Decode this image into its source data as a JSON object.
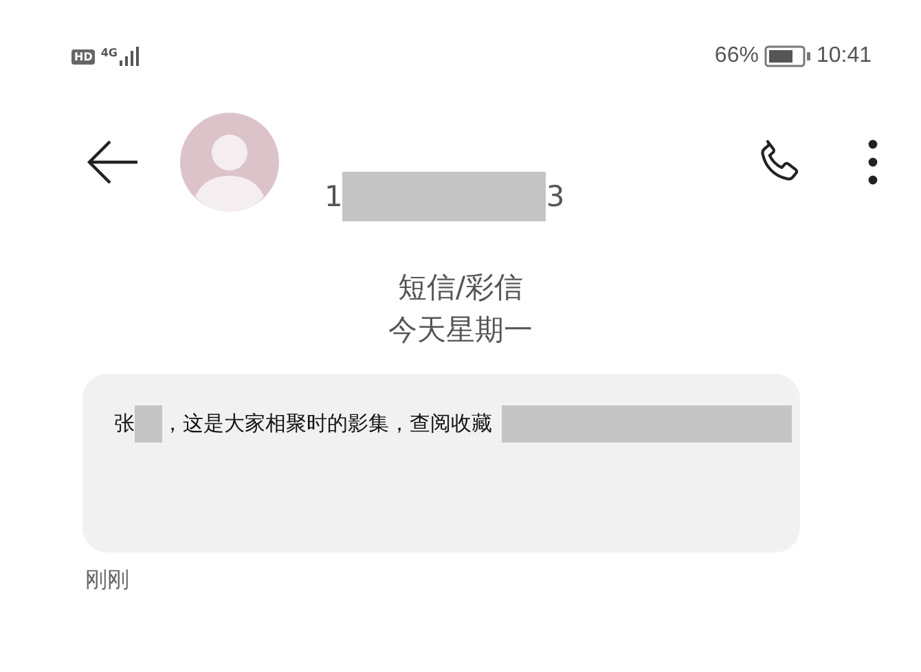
{
  "status_bar": {
    "hd_badge": "HD",
    "network": "4G",
    "battery": "66%",
    "time": "10:41"
  },
  "header": {
    "number": [
      {
        "kind": "text",
        "text": "1"
      },
      {
        "kind": "redacted"
      },
      {
        "kind": "text",
        "text": "3"
      }
    ]
  },
  "conversation": {
    "channel": "短信/彩信",
    "date": "今天星期一"
  },
  "messages": [
    {
      "parts": [
        {
          "kind": "text",
          "text": "张"
        },
        {
          "kind": "redacted"
        },
        {
          "kind": "text",
          "text": "，这是大家相聚时的影集，查阅收藏"
        },
        {
          "kind": "redacted"
        }
      ],
      "time": "刚刚"
    }
  ]
}
